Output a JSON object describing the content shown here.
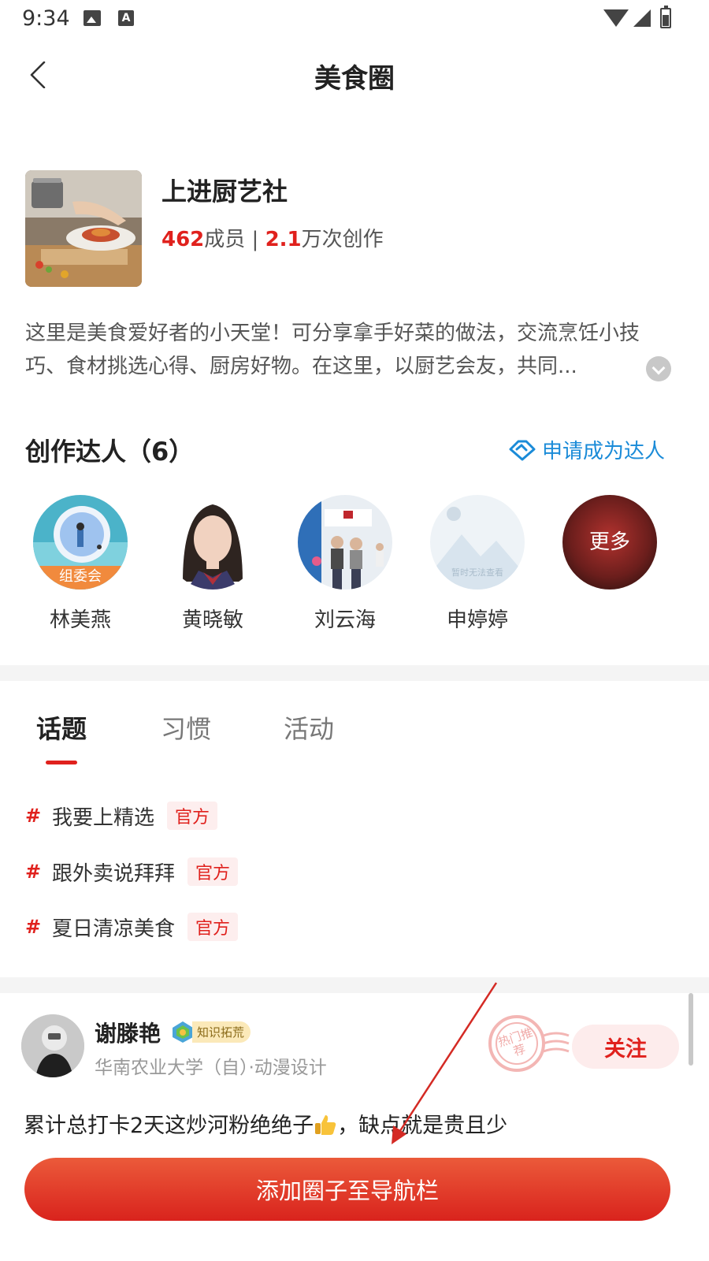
{
  "status_bar": {
    "time": "9:34",
    "icons": [
      "image-notification-icon",
      "a-notification-icon",
      "wifi-icon",
      "signal-icon",
      "battery-icon"
    ]
  },
  "header": {
    "title": "美食圈",
    "back_icon": "chevron-left-icon"
  },
  "circle": {
    "name": "上进厨艺社",
    "members_count": "462",
    "members_label": "成员",
    "separator": " | ",
    "creations_count": "2.1",
    "creations_label": "万次创作",
    "description": "这里是美食爱好者的小天堂！可分享拿手好菜的做法，交流烹饪小技巧、食材挑选心得、厨房好物。在这里，以厨艺会友，共同..."
  },
  "creators": {
    "title": "创作达人（6）",
    "apply_label": "申请成为达人",
    "list": [
      {
        "name": "林美燕",
        "badge": "组委会"
      },
      {
        "name": "黄晓敏"
      },
      {
        "name": "刘云海"
      },
      {
        "name": "申婷婷",
        "placeholder": "暂时无法查看"
      }
    ],
    "more_label": "更多"
  },
  "tabs": [
    {
      "label": "话题",
      "active": true
    },
    {
      "label": "习惯",
      "active": false
    },
    {
      "label": "活动",
      "active": false
    }
  ],
  "topics": [
    {
      "hash": "#",
      "name": "我要上精选",
      "tag": "官方"
    },
    {
      "hash": "#",
      "name": "跟外卖说拜拜",
      "tag": "官方"
    },
    {
      "hash": "#",
      "name": "夏日清凉美食",
      "tag": "官方"
    }
  ],
  "post": {
    "author": "谢滕艳",
    "badge_label": "知识拓荒",
    "school": "华南农业大学（自）·动漫设计",
    "stamp_text": "热门推荐",
    "follow_label": "关注",
    "content_before": "累计总打卡2天这炒河粉绝绝子",
    "content_after": "，缺点就是贵且少"
  },
  "bottom_button": {
    "label": "添加圈子至导航栏"
  },
  "colors": {
    "accent_red": "#e0211d",
    "link_blue": "#1a8bd8",
    "tag_bg": "#fdeeee",
    "button_gradient_top": "#eb5a3a",
    "button_gradient_bottom": "#d9231d"
  }
}
